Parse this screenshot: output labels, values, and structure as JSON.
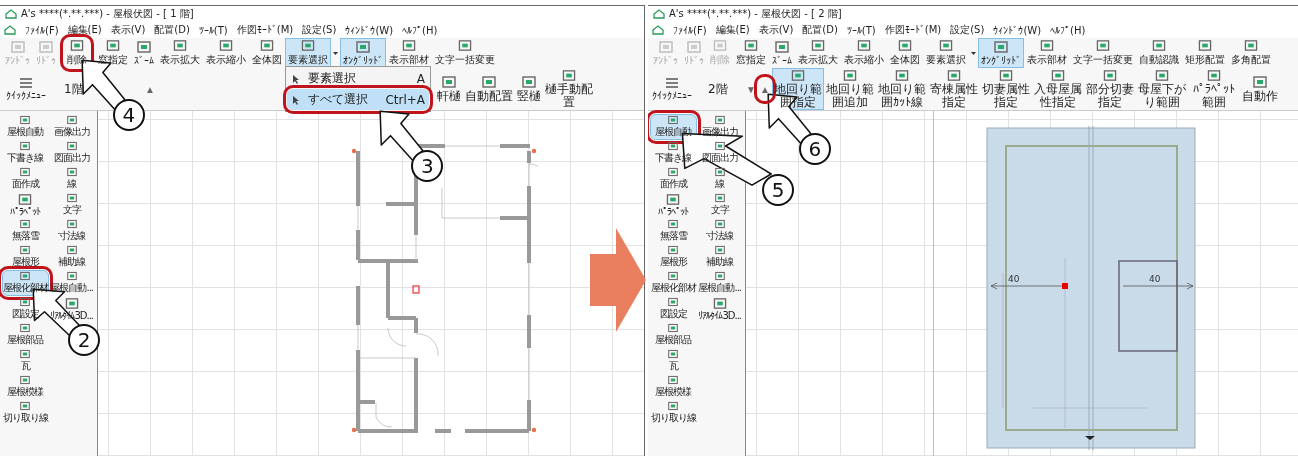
{
  "windows": [
    {
      "title": "A's ****(*.**.***) - 屋根伏図 - [ 1 階]",
      "menu": [
        "ﾌｧｲﾙ(F)",
        "編集(E)",
        "表示(V)",
        "配置(D)",
        "ﾂｰﾙ(T)",
        "作図ﾓｰﾄﾞ(M)",
        "設定(S)",
        "ｳｨﾝﾄﾞｳ(W)",
        "ﾍﾙﾌﾟ(H)"
      ],
      "toolbar": [
        {
          "label": "ｱﾝﾄﾞｩ",
          "disabled": true,
          "pressed": false
        },
        {
          "label": "ﾘﾄﾞｩ",
          "disabled": true,
          "pressed": false
        },
        {
          "label": "削除",
          "disabled": false,
          "pressed": false,
          "callout": "4"
        },
        {
          "label": "窓指定",
          "disabled": false,
          "pressed": false
        },
        {
          "label": "ｽﾞｰﾑ",
          "disabled": false,
          "pressed": false
        },
        {
          "label": "表示拡大",
          "disabled": false,
          "pressed": false
        },
        {
          "label": "表示縮小",
          "disabled": false,
          "pressed": false
        },
        {
          "label": "全体図",
          "disabled": false,
          "pressed": false
        },
        {
          "label": "要素選択",
          "disabled": false,
          "pressed": true,
          "caret": true,
          "menu": [
            {
              "label": "要素選択",
              "shortcut": "A",
              "selected": false
            },
            {
              "label": "すべて選択",
              "shortcut": "Ctrl+A",
              "selected": true,
              "callout": "3"
            }
          ]
        },
        {
          "label": "ｵﾝｸﾞﾘｯﾄﾞ",
          "disabled": false,
          "pressed": true
        },
        {
          "label": "表示部材",
          "disabled": false,
          "pressed": false
        },
        {
          "label": "文字一括変更",
          "disabled": false,
          "pressed": false
        }
      ],
      "quick_menu": "ｸｲｯｸﾒﾆｭｰ",
      "floor": "1階",
      "floor_buttons": [
        {
          "label": "▲"
        }
      ],
      "tools": [
        {
          "label": "軒樋",
          "selected": false
        },
        {
          "label": "自動配置",
          "selected": false
        },
        {
          "label": "竪樋",
          "selected": false
        },
        {
          "label": "樋手動配置",
          "selected": false
        }
      ],
      "sidebar": [
        {
          "label": "屋根自動",
          "selected": false
        },
        {
          "label": "画像出力",
          "selected": false
        },
        {
          "label": "下書き線",
          "selected": false
        },
        {
          "label": "図面出力",
          "selected": false
        },
        {
          "label": "面作成",
          "selected": false
        },
        {
          "label": "線",
          "selected": false
        },
        {
          "label": "ﾊﾟﾗﾍﾟｯﾄ",
          "selected": false
        },
        {
          "label": "文字",
          "selected": false
        },
        {
          "label": "無落雪",
          "selected": false
        },
        {
          "label": "寸法線",
          "selected": false
        },
        {
          "label": "屋根形",
          "selected": false
        },
        {
          "label": "補助線",
          "selected": false
        },
        {
          "label": "屋根化部材",
          "selected": true,
          "callout": "2"
        },
        {
          "label": "屋根自動...",
          "selected": false
        },
        {
          "label": "図設定",
          "selected": false
        },
        {
          "label": "ﾘｱﾙﾀｲﾑ3D...",
          "selected": false
        },
        {
          "label": "屋根部品",
          "selected": false
        },
        {
          "label": "瓦",
          "selected": false
        },
        {
          "label": "屋根模様",
          "selected": false
        },
        {
          "label": "切り取り線",
          "selected": false
        }
      ],
      "canvas": {
        "kind": "floor_plan"
      }
    },
    {
      "title": "A's ****(*.**.***) - 屋根伏図 - [ 2 階]",
      "menu": [
        "ﾌｧｲﾙ(F)",
        "編集(E)",
        "表示(V)",
        "配置(D)",
        "ﾂｰﾙ(T)",
        "作図ﾓｰﾄﾞ(M)",
        "設定(S)",
        "ｳｨﾝﾄﾞｳ(W)",
        "ﾍﾙﾌﾟ(H)"
      ],
      "toolbar": [
        {
          "label": "ｱﾝﾄﾞｩ",
          "disabled": true,
          "pressed": false
        },
        {
          "label": "ﾘﾄﾞｩ",
          "disabled": true,
          "pressed": false
        },
        {
          "label": "削除",
          "disabled": true,
          "pressed": false
        },
        {
          "label": "窓指定",
          "disabled": false,
          "pressed": false
        },
        {
          "label": "ｽﾞｰﾑ",
          "disabled": false,
          "pressed": false
        },
        {
          "label": "表示拡大",
          "disabled": false,
          "pressed": false
        },
        {
          "label": "表示縮小",
          "disabled": false,
          "pressed": false
        },
        {
          "label": "全体図",
          "disabled": false,
          "pressed": false
        },
        {
          "label": "要素選択",
          "disabled": false,
          "pressed": false,
          "caret": true
        },
        {
          "label": "ｵﾝｸﾞﾘｯﾄﾞ",
          "disabled": false,
          "pressed": true
        },
        {
          "label": "表示部材",
          "disabled": false,
          "pressed": false
        },
        {
          "label": "文字一括変更",
          "disabled": false,
          "pressed": false
        },
        {
          "label": "自動認識",
          "disabled": false,
          "pressed": false
        },
        {
          "label": "矩形配置",
          "disabled": false,
          "pressed": false
        },
        {
          "label": "多角配置",
          "disabled": false,
          "pressed": false
        }
      ],
      "quick_menu": "ｸｲｯｸﾒﾆｭｰ",
      "floor": "2階",
      "floor_buttons": [
        {
          "label": "▼"
        },
        {
          "label": "▲",
          "callout": "6"
        }
      ],
      "tools": [
        {
          "label": "地回り範囲指定",
          "selected": true
        },
        {
          "label": "地回り範囲追加",
          "selected": false
        },
        {
          "label": "地回り範囲ｶｯﾄ線",
          "selected": false
        },
        {
          "label": "寄棟属性指定",
          "selected": false
        },
        {
          "label": "切妻属性指定",
          "selected": false
        },
        {
          "label": "入母屋属性指定",
          "selected": false
        },
        {
          "label": "部分切妻指定",
          "selected": false
        },
        {
          "label": "母屋下がり範囲",
          "selected": false
        },
        {
          "label": "ﾊﾟﾗﾍﾟｯﾄ範囲",
          "selected": false
        },
        {
          "label": "自動作",
          "selected": false
        }
      ],
      "sidebar": [
        {
          "label": "屋根自動",
          "selected": true,
          "callout": "5"
        },
        {
          "label": "画像出力",
          "selected": false
        },
        {
          "label": "下書き線",
          "selected": false
        },
        {
          "label": "図面出力",
          "selected": false
        },
        {
          "label": "面作成",
          "selected": false
        },
        {
          "label": "線",
          "selected": false
        },
        {
          "label": "ﾊﾟﾗﾍﾟｯﾄ",
          "selected": false
        },
        {
          "label": "文字",
          "selected": false
        },
        {
          "label": "無落雪",
          "selected": false
        },
        {
          "label": "寸法線",
          "selected": false
        },
        {
          "label": "屋根形",
          "selected": false
        },
        {
          "label": "補助線",
          "selected": false
        },
        {
          "label": "屋根化部材",
          "selected": false
        },
        {
          "label": "屋根自動...",
          "selected": false
        },
        {
          "label": "図設定",
          "selected": false
        },
        {
          "label": "ﾘｱﾙﾀｲﾑ3D...",
          "selected": false
        },
        {
          "label": "屋根部品",
          "selected": false
        },
        {
          "label": "瓦",
          "selected": false
        },
        {
          "label": "屋根模様",
          "selected": false
        },
        {
          "label": "切り取り線",
          "selected": false
        }
      ],
      "canvas": {
        "kind": "roof",
        "dimension_labels": [
          "40",
          "40"
        ]
      }
    }
  ]
}
